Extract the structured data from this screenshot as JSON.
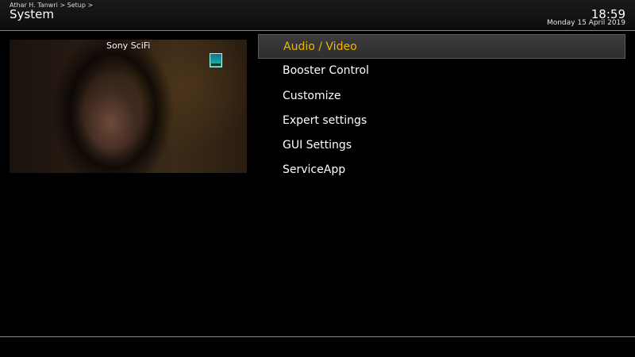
{
  "header": {
    "breadcrumb": "Athar H. Tanwri > Setup >",
    "title": "System",
    "clock": "18:59",
    "date": "Monday 15 April 2019"
  },
  "preview": {
    "channel_name": "Sony SciFi",
    "logo_icon": "channel-logo-icon"
  },
  "menu": {
    "items": [
      {
        "label": "Audio / Video",
        "selected": true
      },
      {
        "label": "Booster Control",
        "selected": false
      },
      {
        "label": "Customize",
        "selected": false
      },
      {
        "label": "Expert settings",
        "selected": false
      },
      {
        "label": "GUI Settings",
        "selected": false
      },
      {
        "label": "ServiceApp",
        "selected": false
      }
    ]
  },
  "colors": {
    "background": "#000000",
    "selected_text": "#f0b400",
    "text": "#ffffff",
    "separator": "#8a8a8a"
  }
}
